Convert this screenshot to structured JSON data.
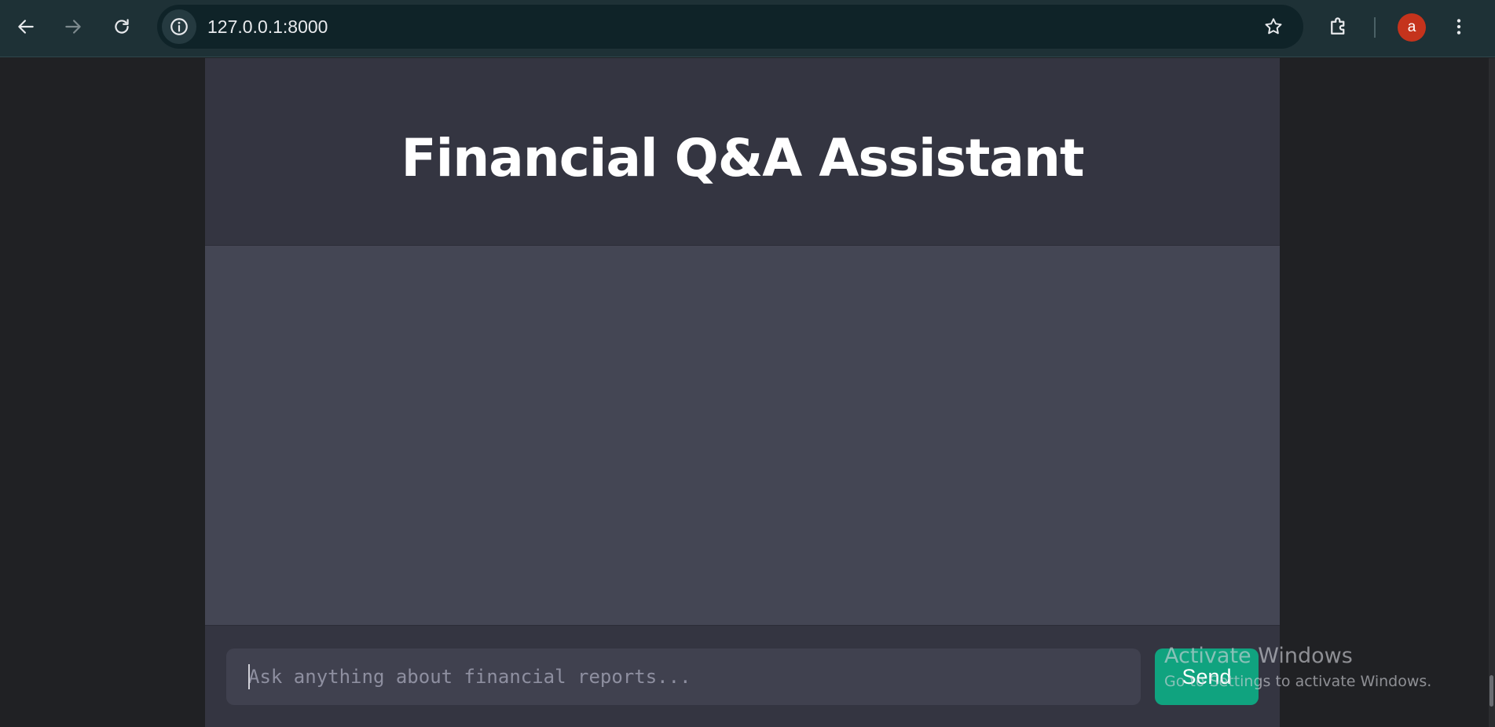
{
  "browser": {
    "url": "127.0.0.1:8000",
    "avatar_initial": "a",
    "icons": {
      "back": "arrow-left-icon",
      "forward": "arrow-right-icon",
      "reload": "reload-icon",
      "site_info": "info-icon",
      "bookmark": "star-icon",
      "extensions": "puzzle-icon",
      "menu": "kebab-menu-icon"
    }
  },
  "app": {
    "title": "Financial Q&A Assistant",
    "input_placeholder": "Ask anything about financial reports...",
    "input_value": "",
    "send_label": "Send"
  },
  "watermark": {
    "line1": "Activate Windows",
    "line2": "Go to Settings to activate Windows."
  },
  "colors": {
    "browser_toolbar": "#1e3136",
    "omnibox": "#0f2328",
    "header_bg": "#343541",
    "chat_bg": "#444654",
    "input_bg": "#40414f",
    "accent": "#10a37f",
    "avatar": "#c5331c"
  }
}
